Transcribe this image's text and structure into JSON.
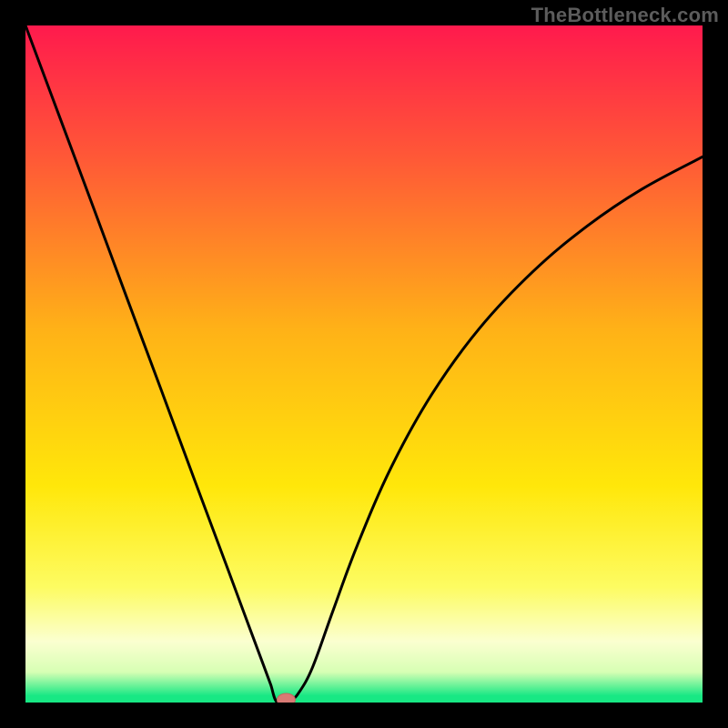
{
  "watermark": "TheBottleneck.com",
  "colors": {
    "background": "#000000",
    "curve": "#000000",
    "marker_fill": "#d87a74",
    "marker_stroke": "#bf675f"
  },
  "chart_data": {
    "type": "line",
    "title": "",
    "xlabel": "",
    "ylabel": "",
    "xlim": [
      0,
      1
    ],
    "ylim": [
      0,
      1
    ],
    "gradient_stops": [
      {
        "offset": 0.0,
        "color": "#ff1a4d"
      },
      {
        "offset": 0.2,
        "color": "#ff5a36"
      },
      {
        "offset": 0.45,
        "color": "#ffb217"
      },
      {
        "offset": 0.68,
        "color": "#ffe70a"
      },
      {
        "offset": 0.83,
        "color": "#fdfc62"
      },
      {
        "offset": 0.91,
        "color": "#fbffd0"
      },
      {
        "offset": 0.955,
        "color": "#d7ffb4"
      },
      {
        "offset": 0.99,
        "color": "#18e884"
      },
      {
        "offset": 1.0,
        "color": "#18e884"
      }
    ],
    "curve": {
      "minimum_x": 0.372,
      "points": [
        {
          "x": 0.0,
          "y": 1.0
        },
        {
          "x": 0.05,
          "y": 0.866
        },
        {
          "x": 0.1,
          "y": 0.732
        },
        {
          "x": 0.15,
          "y": 0.597
        },
        {
          "x": 0.2,
          "y": 0.463
        },
        {
          "x": 0.25,
          "y": 0.328
        },
        {
          "x": 0.3,
          "y": 0.194
        },
        {
          "x": 0.33,
          "y": 0.113
        },
        {
          "x": 0.352,
          "y": 0.054
        },
        {
          "x": 0.362,
          "y": 0.027
        },
        {
          "x": 0.372,
          "y": 0.0
        },
        {
          "x": 0.392,
          "y": 0.004
        },
        {
          "x": 0.404,
          "y": 0.015
        },
        {
          "x": 0.424,
          "y": 0.052
        },
        {
          "x": 0.454,
          "y": 0.135
        },
        {
          "x": 0.49,
          "y": 0.232
        },
        {
          "x": 0.54,
          "y": 0.347
        },
        {
          "x": 0.6,
          "y": 0.455
        },
        {
          "x": 0.67,
          "y": 0.552
        },
        {
          "x": 0.75,
          "y": 0.637
        },
        {
          "x": 0.83,
          "y": 0.704
        },
        {
          "x": 0.91,
          "y": 0.758
        },
        {
          "x": 1.0,
          "y": 0.806
        }
      ]
    },
    "marker": {
      "x": 0.385,
      "y": 0.004,
      "rx": 10,
      "ry": 7
    }
  }
}
